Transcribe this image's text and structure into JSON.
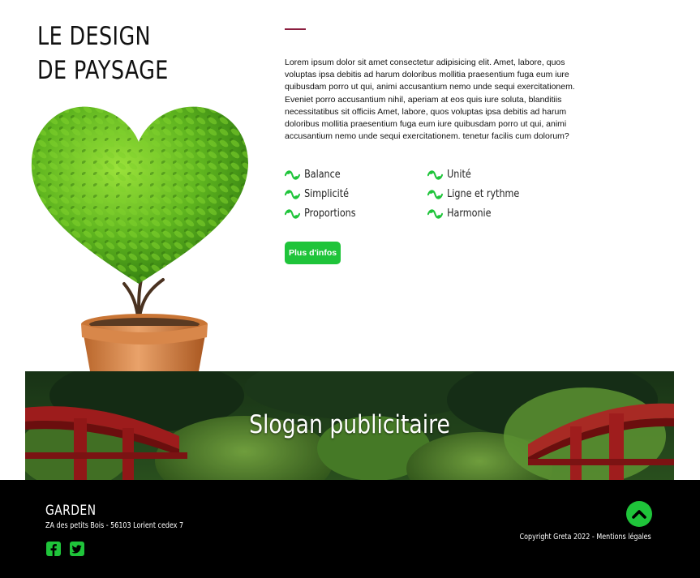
{
  "header": {
    "title_line1": "LE DESIGN",
    "title_line2": "DE PAYSAGE"
  },
  "intro": {
    "text": "Lorem ipsum dolor sit amet consectetur adipisicing elit. Amet, labore, quos voluptas ipsa debitis ad harum doloribus mollitia praesentium fuga eum iure quibusdam porro ut qui, animi accusantium nemo unde sequi exercitationem. Eveniet porro accusantium nihil, aperiam at eos quis iure soluta, blanditiis necessitatibus sit officiis Amet, labore, quos voluptas ipsa debitis ad harum doloribus mollitia praesentium fuga eum iure quibusdam porro ut qui, animi accusantium nemo unde sequi exercitationem. tenetur facilis cum dolorum?"
  },
  "features": [
    {
      "label": "Balance",
      "icon": "leaf-swirl-icon"
    },
    {
      "label": "Unité",
      "icon": "leaf-swirl-icon"
    },
    {
      "label": "Simplicité",
      "icon": "leaf-swirl-icon"
    },
    {
      "label": "Ligne et rythme",
      "icon": "leaf-swirl-icon"
    },
    {
      "label": "Proportions",
      "icon": "leaf-swirl-icon"
    },
    {
      "label": "Harmonie",
      "icon": "leaf-swirl-icon"
    }
  ],
  "cta": {
    "label": "Plus d'infos"
  },
  "banner": {
    "slogan": "Slogan publicitaire"
  },
  "footer": {
    "brand": "GARDEN",
    "address": "ZA des petits Bois - 56103 Lorient cedex 7",
    "socials": [
      "facebook-icon",
      "twitter-icon"
    ],
    "copyright": "Copyright Greta 2022 - Mentions légales",
    "scroll_top_icon": "chevron-up-icon"
  },
  "colors": {
    "accent_green": "#1fc43a",
    "accent_line": "#8b1e3f",
    "footer_bg": "#000000"
  }
}
